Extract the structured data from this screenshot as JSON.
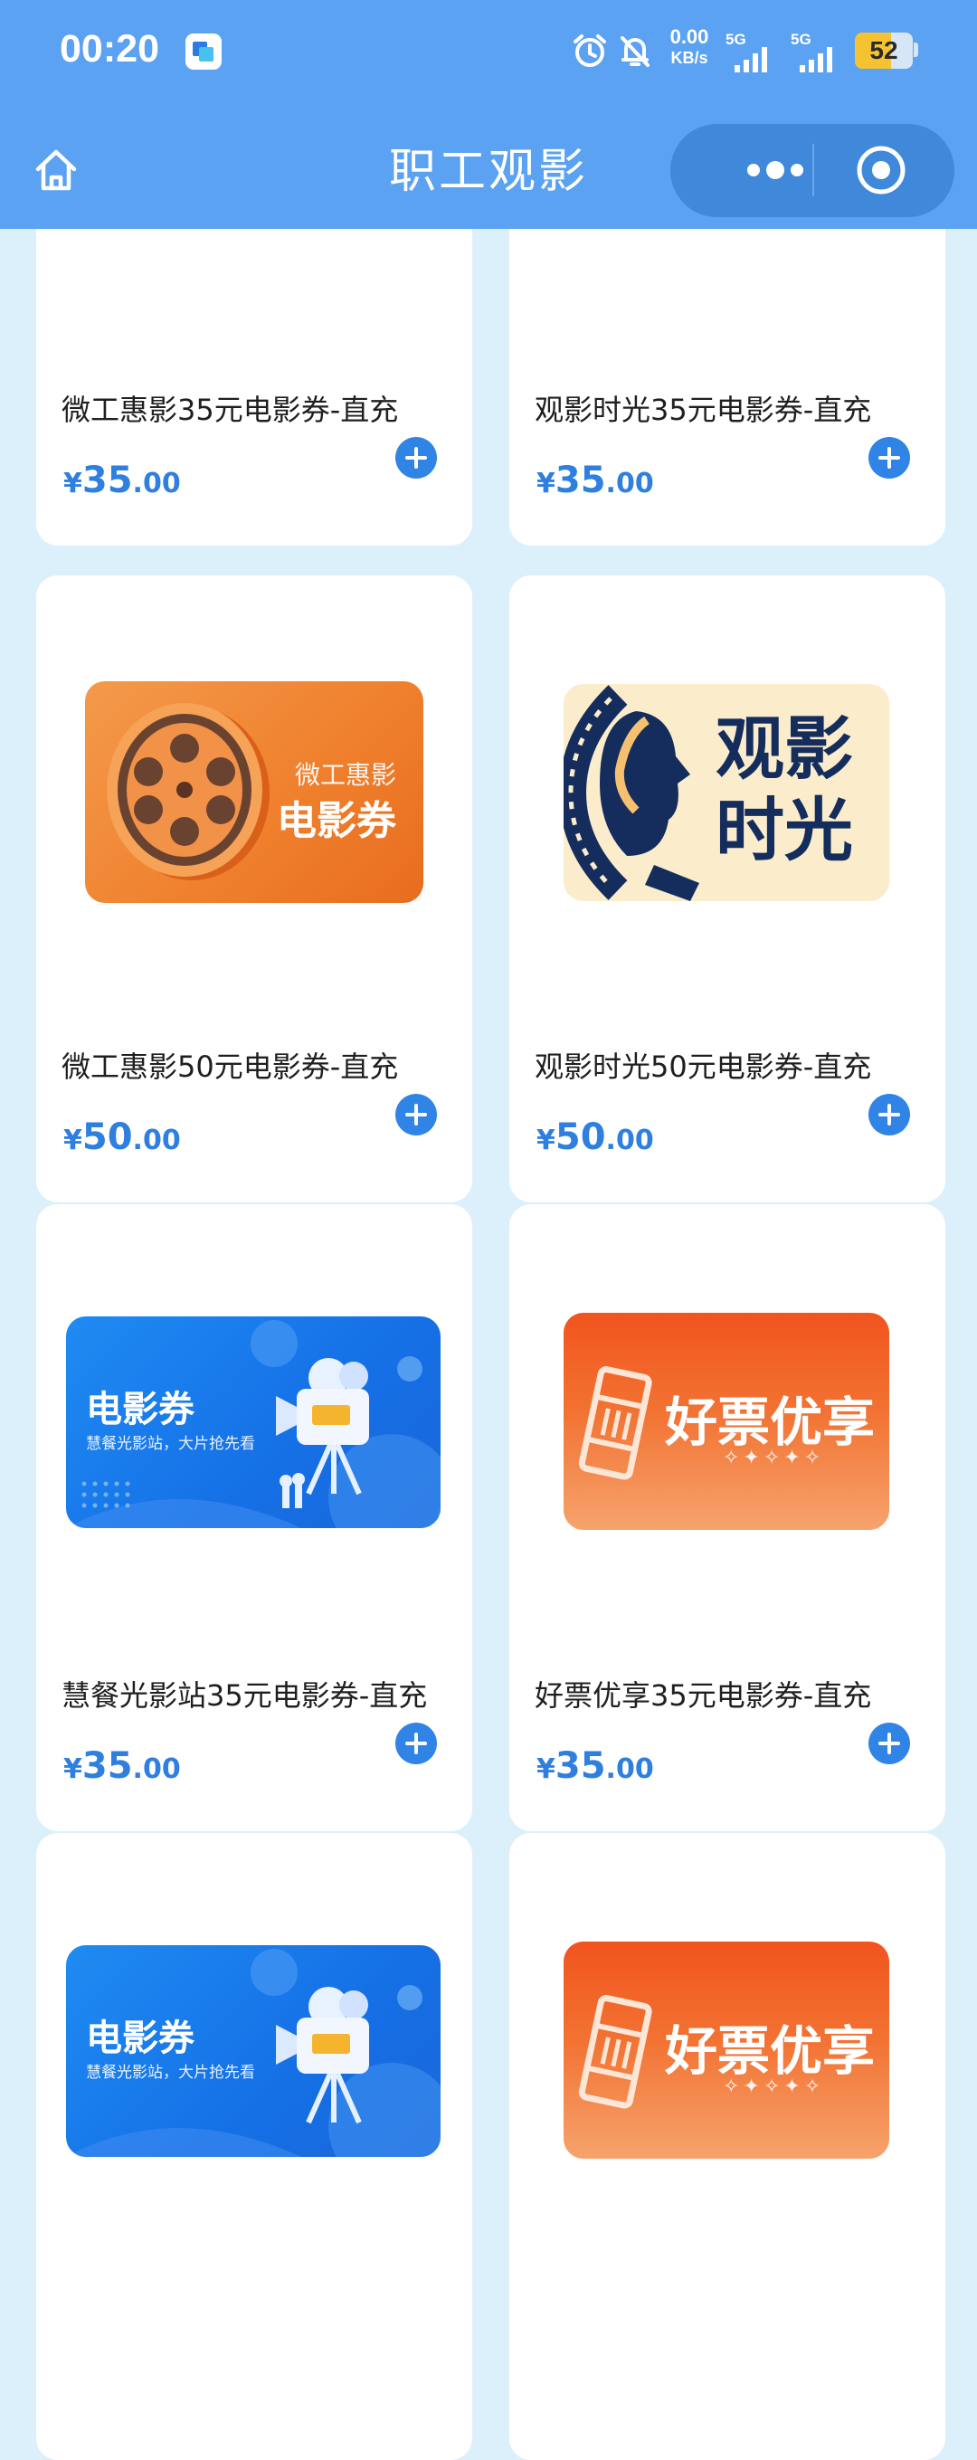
{
  "status_bar": {
    "time": "00:20",
    "speed_value": "0.00",
    "speed_unit": "KB/s",
    "net1": "5G",
    "net2": "5G",
    "battery": "52"
  },
  "header": {
    "title": "职工观影"
  },
  "products": [
    {
      "name": "微工惠影35元电影券-直充",
      "currency": "¥",
      "price_int": "35",
      "price_dec": ".00",
      "thumb": "wgh"
    },
    {
      "name": "观影时光35元电影券-直充",
      "currency": "¥",
      "price_int": "35",
      "price_dec": ".00",
      "thumb": "gysg"
    },
    {
      "name": "微工惠影50元电影券-直充",
      "currency": "¥",
      "price_int": "50",
      "price_dec": ".00",
      "thumb": "wgh"
    },
    {
      "name": "观影时光50元电影券-直充",
      "currency": "¥",
      "price_int": "50",
      "price_dec": ".00",
      "thumb": "gysg"
    },
    {
      "name": "慧餐光影站35元电影券-直充",
      "currency": "¥",
      "price_int": "35",
      "price_dec": ".00",
      "thumb": "hcgyz"
    },
    {
      "name": "好票优享35元电影券-直充",
      "currency": "¥",
      "price_int": "35",
      "price_dec": ".00",
      "thumb": "hpyx"
    }
  ],
  "thumbs": {
    "wgh": {
      "line1": "微工惠影",
      "line2": "电影券"
    },
    "gysg": {
      "line1": "观影",
      "line2": "时光"
    },
    "hcgyz": {
      "line1": "电影券",
      "line2": "慧餐光影站，大片抢先看"
    },
    "hpyx": {
      "line1": "好票优享",
      "line2": "✧✦✧✦✧"
    }
  },
  "colors": {
    "header_bg": "#5ba2f2",
    "page_bg": "#dcf0fc",
    "price": "#2f7fe0",
    "add_button": "#2f84e6"
  }
}
